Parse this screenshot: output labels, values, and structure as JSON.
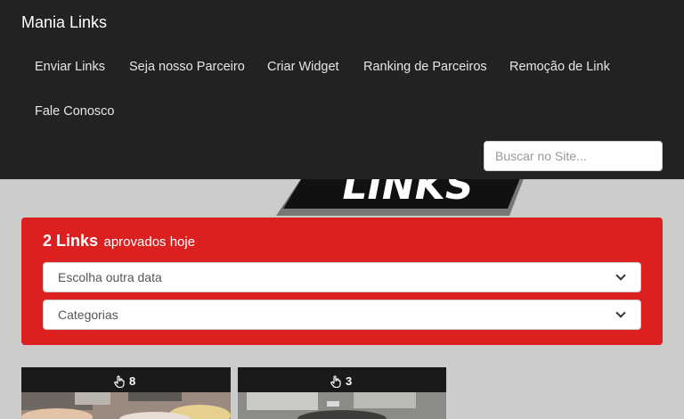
{
  "navbar": {
    "brand": "Mania Links",
    "links": [
      "Enviar Links",
      "Seja nosso Parceiro",
      "Criar Widget",
      "Ranking de Parceiros",
      "Remoção de Link",
      "Fale Conosco"
    ],
    "search_placeholder": "Buscar no Site..."
  },
  "logo": {
    "text": "LINKS"
  },
  "panel": {
    "count": "2 Links",
    "suffix": "aprovados hoje",
    "date_select": "Escolha outra data",
    "category_select": "Categorias"
  },
  "cards": [
    {
      "likes": "8"
    },
    {
      "likes": "3"
    }
  ],
  "colors": {
    "navbar": "#222222",
    "panel": "#dc1f1f",
    "background": "#cccccc"
  }
}
